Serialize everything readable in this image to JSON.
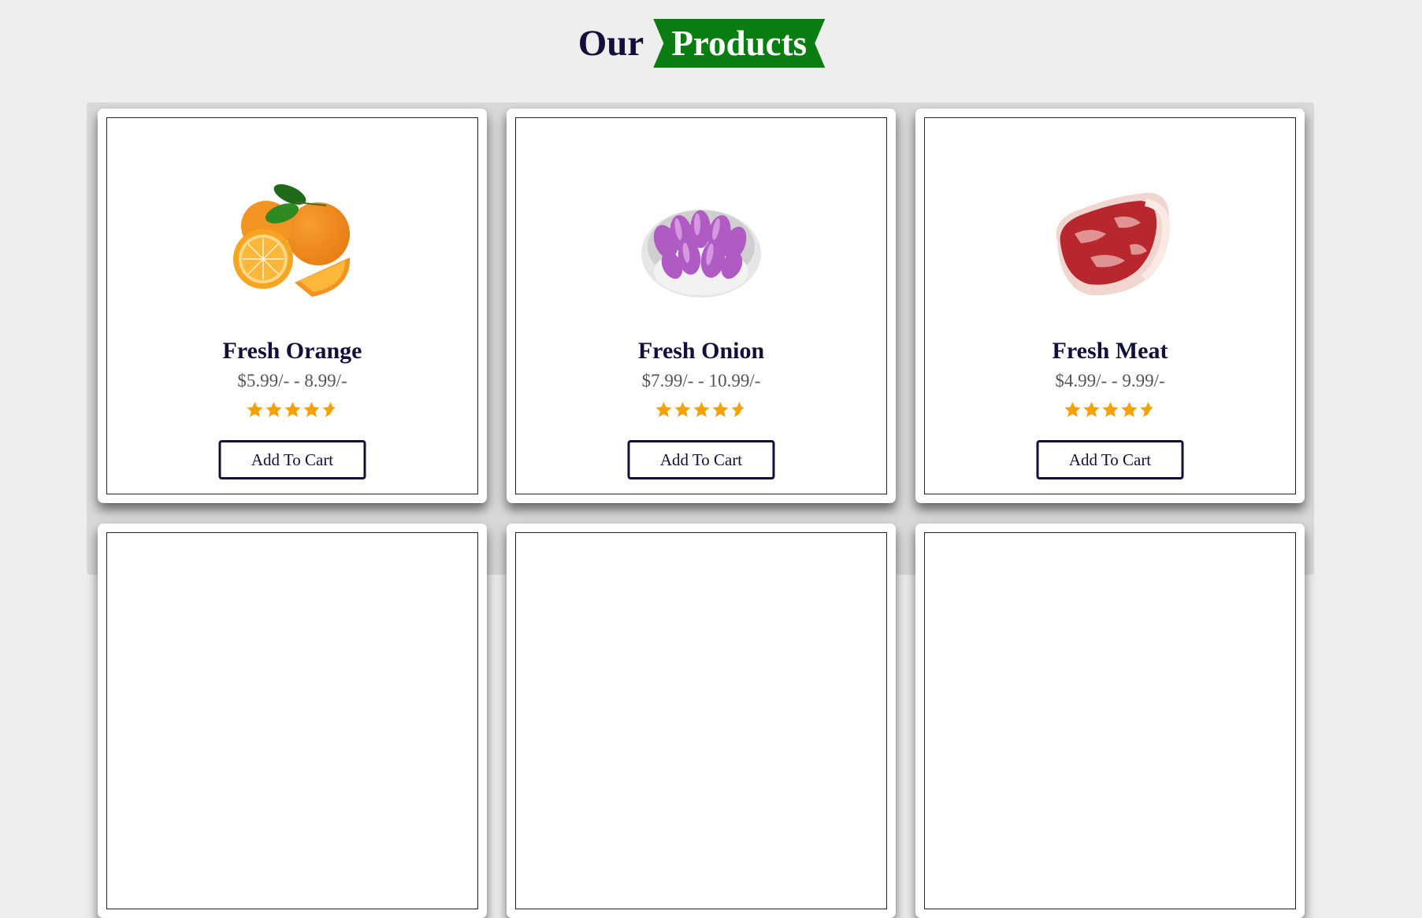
{
  "section": {
    "heading_word": "Our",
    "heading_highlight": "Products",
    "accent_color": "#0a7d12",
    "text_color": "#120f3a",
    "star_color": "#f5a100"
  },
  "products": [
    {
      "name": "Fresh Orange",
      "price": "$5.99/- - 8.99/-",
      "rating": 4.5,
      "cta": "Add To Cart",
      "image": "orange-image"
    },
    {
      "name": "Fresh Onion",
      "price": "$7.99/- - 10.99/-",
      "rating": 4.5,
      "cta": "Add To Cart",
      "image": "onion-image"
    },
    {
      "name": "Fresh Meat",
      "price": "$4.99/- - 9.99/-",
      "rating": 4.5,
      "cta": "Add To Cart",
      "image": "meat-image"
    }
  ]
}
